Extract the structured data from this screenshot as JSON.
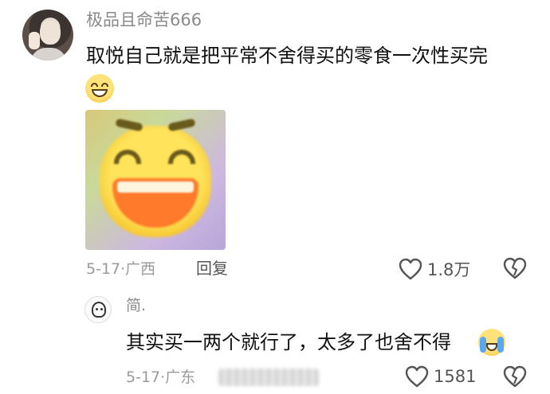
{
  "comment": {
    "username": "极品且命苦666",
    "text": "取悦自己就是把平常不舍得买的零食一次性买完",
    "inline_emoji": "grinning-sweat-emoji",
    "sticker": "laughing-face-sticker",
    "date": "5-17",
    "location": "广西",
    "reply_label": "回复",
    "likes": "1.8万"
  },
  "reply": {
    "username": "简.",
    "text": "其实买一两个就行了，太多了也舍不得",
    "emoji": "crying-face-emoji",
    "date": "5-17",
    "location": "广东",
    "likes": "1581"
  },
  "colors": {
    "meta_gray": "#9a9a9a",
    "username_gray": "#8a8a8a",
    "text": "#111111"
  }
}
